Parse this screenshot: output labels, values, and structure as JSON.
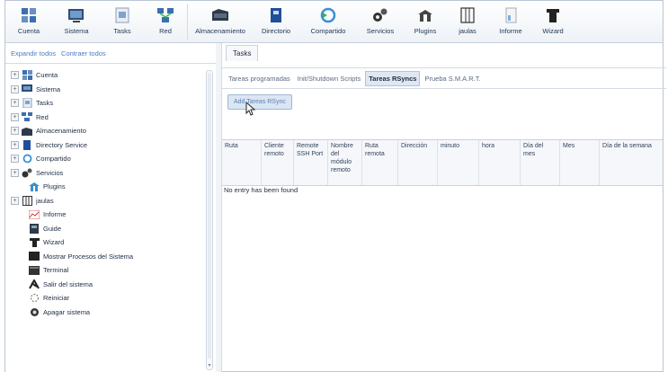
{
  "toolbar": {
    "items": [
      {
        "label": "Cuenta",
        "icon": "account-icon"
      },
      {
        "label": "Sistema",
        "icon": "system-icon"
      },
      {
        "label": "Tasks",
        "icon": "tasks-icon"
      },
      {
        "label": "Red",
        "icon": "network-icon"
      },
      {
        "label": "Almacenamiento",
        "icon": "storage-icon"
      },
      {
        "label": "Directorio",
        "icon": "directory-icon"
      },
      {
        "label": "Compartido",
        "icon": "shared-icon"
      },
      {
        "label": "Servicios",
        "icon": "services-icon"
      },
      {
        "label": "Plugins",
        "icon": "plugins-icon"
      },
      {
        "label": "jaulas",
        "icon": "jails-icon"
      },
      {
        "label": "Informe",
        "icon": "report-icon"
      },
      {
        "label": "Wizard",
        "icon": "wizard-icon"
      }
    ]
  },
  "left": {
    "expand_all": "Expandir todos",
    "collapse_all": "Contraer todos",
    "tree": [
      {
        "label": "Cuenta",
        "expandable": true,
        "icon": "account-icon"
      },
      {
        "label": "Sistema",
        "expandable": true,
        "icon": "system-icon"
      },
      {
        "label": "Tasks",
        "expandable": true,
        "icon": "tasks-icon"
      },
      {
        "label": "Red",
        "expandable": true,
        "icon": "network-icon"
      },
      {
        "label": "Almacenamiento",
        "expandable": true,
        "icon": "storage-icon"
      },
      {
        "label": "Directory Service",
        "expandable": true,
        "icon": "directory-icon"
      },
      {
        "label": "Compartido",
        "expandable": true,
        "icon": "shared-icon"
      },
      {
        "label": "Servicios",
        "expandable": true,
        "icon": "services-icon"
      },
      {
        "label": "Plugins",
        "expandable": false,
        "icon": "plugins-icon"
      },
      {
        "label": "jaulas",
        "expandable": true,
        "icon": "jails-icon"
      },
      {
        "label": "Informe",
        "expandable": false,
        "icon": "report-icon"
      },
      {
        "label": "Guide",
        "expandable": false,
        "icon": "guide-icon"
      },
      {
        "label": "Wizard",
        "expandable": false,
        "icon": "wizard-icon"
      },
      {
        "label": "Mostrar Procesos del Sistema",
        "expandable": false,
        "icon": "processes-icon"
      },
      {
        "label": "Terminal",
        "expandable": false,
        "icon": "terminal-icon"
      },
      {
        "label": "Salir del sistema",
        "expandable": false,
        "icon": "logout-icon"
      },
      {
        "label": "Reiniciar",
        "expandable": false,
        "icon": "reboot-icon"
      },
      {
        "label": "Apagar sistema",
        "expandable": false,
        "icon": "shutdown-icon"
      }
    ]
  },
  "main": {
    "tab": "Tasks",
    "subtabs": [
      "Tareas programadas",
      "Init/Shutdown Scripts",
      "Tareas RSyncs",
      "Prueba S.M.A.R.T."
    ],
    "active_subtab": 2,
    "add_button": "Add Tareas RSync",
    "columns": [
      "Ruta",
      "Cliente remoto",
      "Remote SSH Port",
      "Nombre del módulo remoto",
      "Ruta remota",
      "Dirección",
      "minuto",
      "hora",
      "Día del mes",
      "Mes",
      "Día de la semana"
    ],
    "empty_text": "No entry has been found"
  },
  "colors": {
    "accent": "#4a7cc0",
    "border": "#c4cfdb",
    "header_bg": "#f5f7fa"
  }
}
